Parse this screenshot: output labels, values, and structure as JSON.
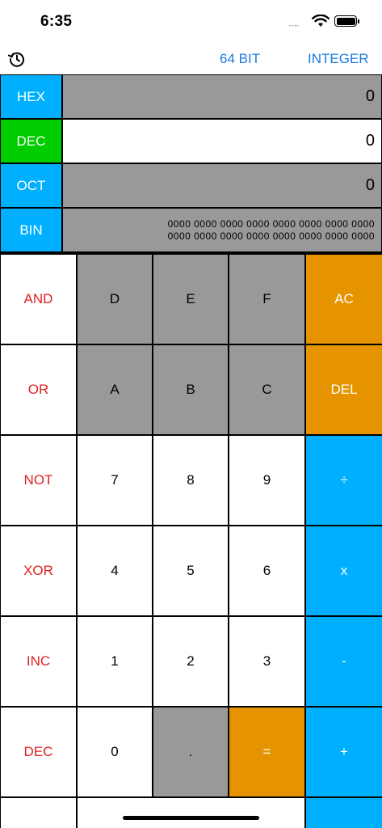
{
  "status": {
    "time": "6:35",
    "signal": "••••"
  },
  "nav": {
    "bits": "64 BIT",
    "mode": "INTEGER"
  },
  "colors": {
    "hex_label": "#00b0ff",
    "dec_label": "#00cc00",
    "gray": "#999999",
    "orange": "#e59400",
    "blue": "#00b0ff",
    "link": "#1a7ae6",
    "op_text": "#e02020"
  },
  "bases": [
    {
      "label": "HEX",
      "value": "0"
    },
    {
      "label": "DEC",
      "value": "0"
    },
    {
      "label": "OCT",
      "value": "0"
    },
    {
      "label": "BIN",
      "value": "0000 0000 0000 0000 0000 0000 0000 0000\n0000 0000 0000 0000 0000 0000 0000 0000"
    }
  ],
  "keys": {
    "and": "AND",
    "or": "OR",
    "not": "NOT",
    "xor": "XOR",
    "inc": "INC",
    "dec": "DEC",
    "d": "D",
    "e": "E",
    "f": "F",
    "a": "A",
    "b": "B",
    "c": "C",
    "n7": "7",
    "n8": "8",
    "n9": "9",
    "n4": "4",
    "n5": "5",
    "n6": "6",
    "n1": "1",
    "n2": "2",
    "n3": "3",
    "n0": "0",
    "dot": ".",
    "equals": "=",
    "ac": "AC",
    "del": "DEL",
    "divide": "÷",
    "multiply": "x",
    "minus": "-",
    "plus": "+"
  }
}
